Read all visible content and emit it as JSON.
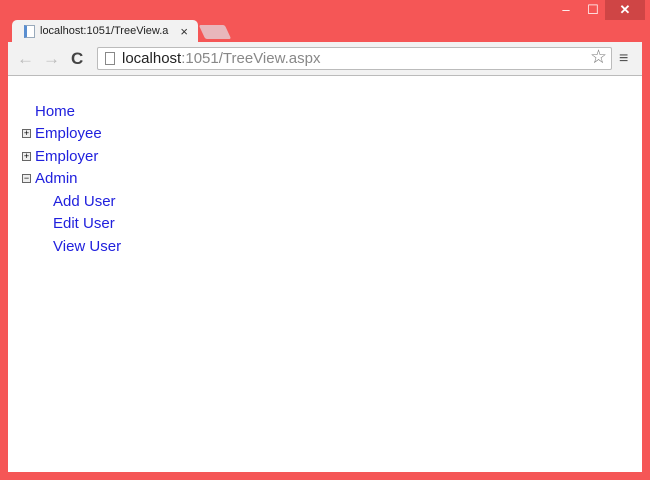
{
  "window": {
    "minimize": "‒",
    "maximize": "☐",
    "close": "✕"
  },
  "tab": {
    "title": "localhost:1051/TreeView.a",
    "close": "×"
  },
  "toolbar": {
    "back": "←",
    "forward": "→",
    "reload": "C",
    "url_host": "localhost",
    "url_rest": ":1051/TreeView.aspx",
    "star": "☆",
    "menu": "≡"
  },
  "tree": {
    "home": "Home",
    "employee": {
      "label": "Employee",
      "toggle": "+"
    },
    "employer": {
      "label": "Employer",
      "toggle": "+"
    },
    "admin": {
      "label": "Admin",
      "toggle": "−",
      "children": [
        "Add User",
        "Edit User",
        "View User"
      ]
    }
  }
}
